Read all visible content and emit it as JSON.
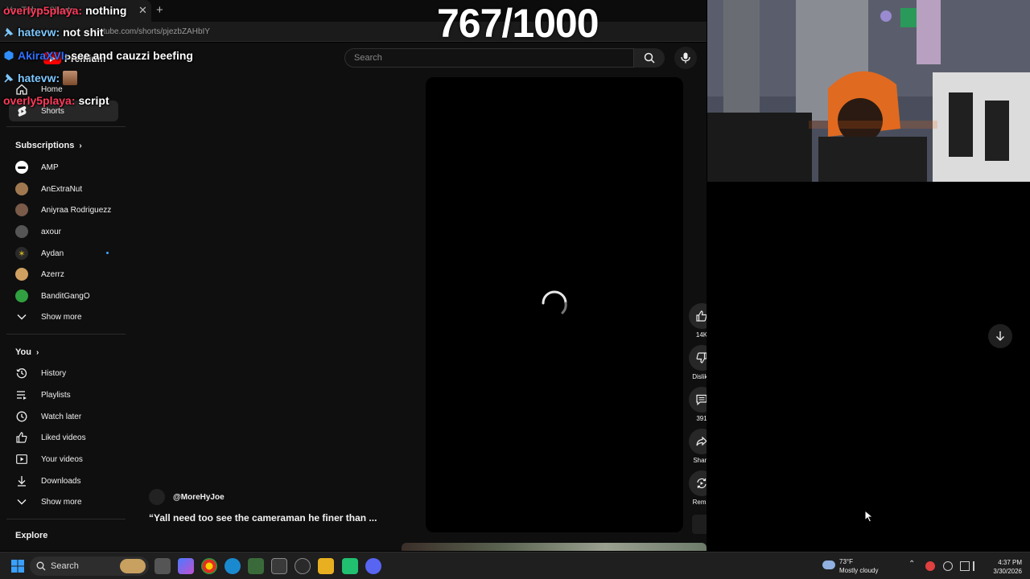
{
  "browser": {
    "tab_title": "YouTube - Shorts",
    "url": "youtube.com/shorts/pjezbZAHbIY"
  },
  "youtube": {
    "logo": "Premium",
    "search_placeholder": "Search",
    "sidebar": {
      "top": [
        {
          "label": "Home",
          "icon": "home-icon"
        },
        {
          "label": "Shorts",
          "icon": "shorts-icon",
          "active": true
        }
      ],
      "subscriptions_header": "Subscriptions",
      "subscriptions": [
        {
          "label": "AMP",
          "color": "#ffffff"
        },
        {
          "label": "AnExtraNut",
          "color": "#a07850"
        },
        {
          "label": "Aniyraa Rodriguezz",
          "color": "#7a5a48"
        },
        {
          "label": "axour",
          "color": "#555555"
        },
        {
          "label": "Aydan",
          "color": "#c8b020",
          "live_dot": true
        },
        {
          "label": "Azerrz",
          "color": "#d0a060"
        },
        {
          "label": "BanditGangO",
          "color": "#30a040"
        }
      ],
      "show_more_1": "Show more",
      "you_header": "You",
      "you_items": [
        {
          "label": "History",
          "icon": "history-icon"
        },
        {
          "label": "Playlists",
          "icon": "playlists-icon"
        },
        {
          "label": "Watch later",
          "icon": "watch-later-icon"
        },
        {
          "label": "Liked videos",
          "icon": "thumbs-up-icon"
        },
        {
          "label": "Your videos",
          "icon": "your-videos-icon"
        },
        {
          "label": "Downloads",
          "icon": "download-icon"
        }
      ],
      "show_more_2": "Show more",
      "explore_header": "Explore"
    },
    "short": {
      "channel": "@MoreHyJoe",
      "caption": "“Yall need too see the cameraman he finer than ...",
      "likes": "14K",
      "dislike_label": "Dislike",
      "comments": "391",
      "share_label": "Share",
      "remix_label": "Remix"
    }
  },
  "overlay": {
    "counter": "767/1000",
    "chat": [
      {
        "user": "overlyp5playa:",
        "message": "nothing",
        "color": "#ff3a5a"
      },
      {
        "user": "hatevw:",
        "message": "not shit",
        "color": "#7ec8ff",
        "badge": true
      },
      {
        "user": "AkiraXVI:",
        "message": "see and cauzzi beefing",
        "color": "#2f6fff",
        "badge": true
      },
      {
        "user": "hatevw:",
        "message": "",
        "color": "#7ec8ff",
        "badge": true,
        "emote": true
      },
      {
        "user": "overly5playa:",
        "message": "script",
        "color": "#ff3a5a"
      }
    ]
  },
  "taskbar": {
    "search_label": "Search",
    "weather_temp": "73°F",
    "weather_desc": "Mostly cloudy",
    "time": "4:37 PM",
    "date": "3/30/2026"
  }
}
